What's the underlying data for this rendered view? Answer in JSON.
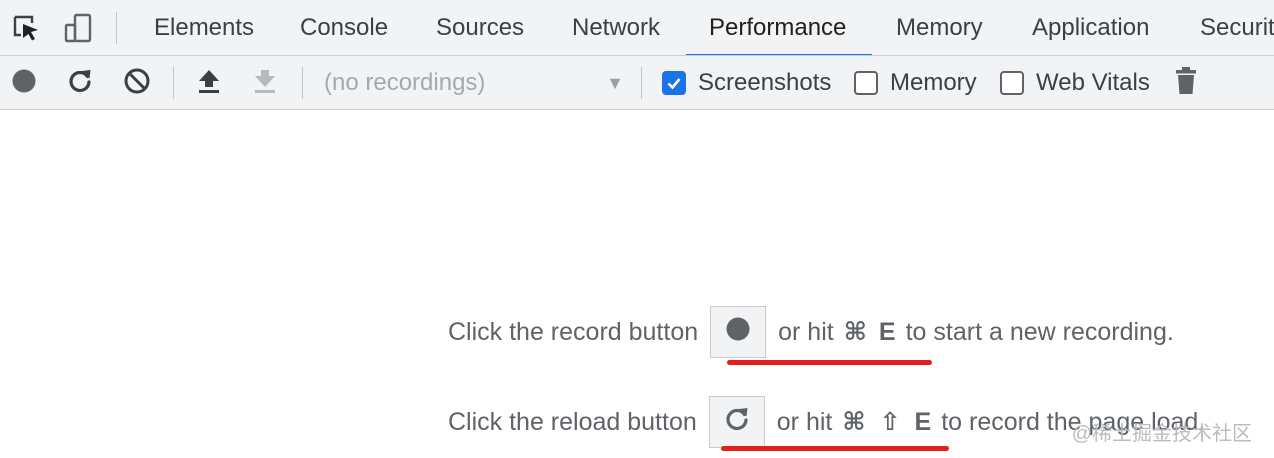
{
  "tabs": {
    "items": [
      {
        "label": "Elements"
      },
      {
        "label": "Console"
      },
      {
        "label": "Sources"
      },
      {
        "label": "Network"
      },
      {
        "label": "Performance",
        "active": true
      },
      {
        "label": "Memory"
      },
      {
        "label": "Application"
      },
      {
        "label": "Securit"
      }
    ]
  },
  "toolbar": {
    "recording_select_value": "(no recordings)",
    "checkboxes": {
      "screenshots": {
        "label": "Screenshots",
        "checked": true
      },
      "memory": {
        "label": "Memory",
        "checked": false
      },
      "web_vitals": {
        "label": "Web Vitals",
        "checked": false
      }
    },
    "icons": [
      "inspect-element-icon",
      "device-toolbar-icon",
      "record-icon",
      "reload-icon",
      "clear-icon",
      "load-profile-icon",
      "save-profile-icon",
      "dropdown-arrow-icon",
      "garbage-collect-icon"
    ]
  },
  "main": {
    "record_line": {
      "before": "Click the record button",
      "after": "or hit",
      "shortcut_cmd": "⌘",
      "shortcut_key": "E",
      "tail": "to start a new recording."
    },
    "reload_line": {
      "before": "Click the reload button",
      "after": "or hit",
      "shortcut_cmd": "⌘",
      "shortcut_shift": "⇧",
      "shortcut_key": "E",
      "tail": "to record the page load."
    },
    "watermark": "@稀土掘金技术社区"
  },
  "colors": {
    "accent": "#1a73e8",
    "annotation_underline": "#e0201b",
    "toolbar_bg": "#f1f3f4"
  }
}
